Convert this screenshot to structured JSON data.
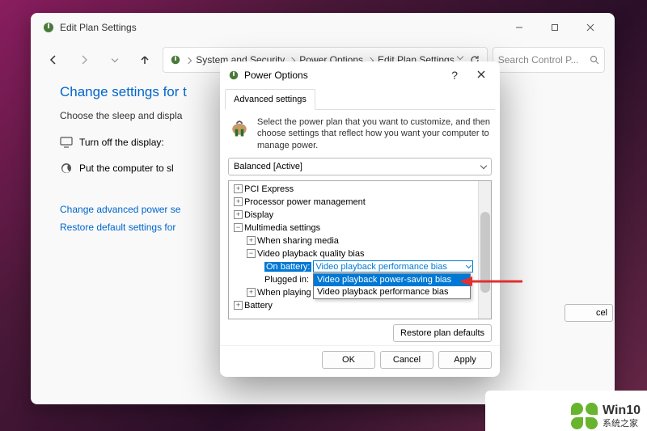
{
  "main_window": {
    "title": "Edit Plan Settings",
    "breadcrumb": [
      "System and Security",
      "Power Options",
      "Edit Plan Settings"
    ],
    "search_placeholder": "Search Control P...",
    "page_title": "Change settings for t",
    "page_sub": "Choose the sleep and displa",
    "row_display": "Turn off the display:",
    "row_sleep": "Put the computer to sl",
    "link_advanced": "Change advanced power se",
    "link_restore": "Restore default settings for"
  },
  "dialog": {
    "title": "Power Options",
    "tab": "Advanced settings",
    "desc": "Select the power plan that you want to customize, and then choose settings that reflect how you want your computer to manage power.",
    "plan_selected": "Balanced [Active]",
    "tree": {
      "pci": "PCI Express",
      "cpu": "Processor power management",
      "display": "Display",
      "multimedia": "Multimedia settings",
      "sharing": "When sharing media",
      "video_bias": "Video playback quality bias",
      "on_battery_label": "On battery:",
      "on_battery_value": "Video playback performance bias",
      "plugged_label": "Plugged in:",
      "playing": "When playing vi",
      "battery": "Battery"
    },
    "dropdown_options": [
      "Video playback power-saving bias",
      "Video playback performance bias"
    ],
    "restore_btn": "Restore plan defaults",
    "ok": "OK",
    "cancel": "Cancel",
    "apply": "Apply",
    "peek_btn": "cel"
  },
  "watermark": {
    "brand_top": "Win10",
    "brand_bottom": "系统之家"
  }
}
